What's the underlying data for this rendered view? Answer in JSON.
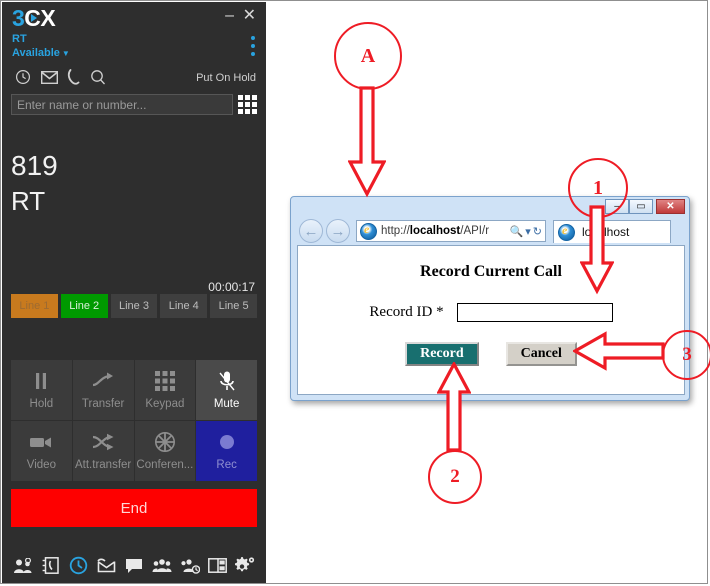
{
  "phone": {
    "brand": "3CX",
    "window_buttons": {
      "minimize": "–",
      "close": "✕"
    },
    "user": "RT",
    "presence": "Available",
    "put_on_hold": "Put On Hold",
    "toolbar_icons": [
      "history-icon",
      "voicemail-icon",
      "call-icon",
      "search-icon"
    ],
    "search": {
      "placeholder": "Enter name or number...",
      "value": ""
    },
    "dialpad_icon": "dialpad-icon",
    "call": {
      "number": "819",
      "name": "RT",
      "duration": "00:00:17"
    },
    "lines": [
      {
        "label": "Line 1",
        "state": "orange"
      },
      {
        "label": "Line 2",
        "state": "green"
      },
      {
        "label": "Line 3",
        "state": "idle"
      },
      {
        "label": "Line 4",
        "state": "idle"
      },
      {
        "label": "Line 5",
        "state": "idle"
      }
    ],
    "keys": [
      {
        "label": "Hold",
        "icon": "pause-icon",
        "state": "normal"
      },
      {
        "label": "Transfer",
        "icon": "transfer-icon",
        "state": "normal"
      },
      {
        "label": "Keypad",
        "icon": "keypad-icon",
        "state": "normal"
      },
      {
        "label": "Mute",
        "icon": "microphone-muted-icon",
        "state": "active"
      },
      {
        "label": "Video",
        "icon": "video-camera-icon",
        "state": "normal"
      },
      {
        "label": "Att.transfer",
        "icon": "attended-transfer-icon",
        "state": "normal"
      },
      {
        "label": "Conferen...",
        "icon": "conference-icon",
        "state": "normal"
      },
      {
        "label": "Rec",
        "icon": "record-dot-icon",
        "state": "recording"
      }
    ],
    "end_label": "End",
    "bottom_icons": [
      "contacts-icon",
      "phonebook-icon",
      "call-history-icon",
      "voicemail-icon",
      "chat-icon",
      "group-icon",
      "group-timer-icon",
      "panel-layout-icon",
      "settings-icon"
    ],
    "colors": {
      "brand_blue": "#29a3e0",
      "line_orange": "#c87a1e",
      "line_green": "#009a00",
      "record_blue": "#1f1f9e",
      "end_red": "#fe0000",
      "panel_bg": "#2e2e2e"
    }
  },
  "browser": {
    "title_buttons": {
      "minimize": "–",
      "maximize": "▭",
      "close": "✕"
    },
    "back_icon": "back-arrow-icon",
    "forward_icon": "forward-arrow-icon",
    "favicon": "internet-explorer-icon",
    "url_prefix": "http://",
    "url_host": "localhost",
    "url_path": "/API/r",
    "url_full": "http://localhost/API/r",
    "search_icon": "magnifier-icon",
    "dropdown_icon": "chevron-down-icon",
    "refresh_icon": "refresh-icon",
    "tab_label": "localhost"
  },
  "dialog": {
    "title": "Record Current Call",
    "field_label": "Record ID *",
    "field_value": "",
    "record_button": "Record",
    "cancel_button": "Cancel",
    "colors": {
      "record_bg": "#186f6f",
      "cancel_bg": "#d4d0c8"
    }
  },
  "annotations": {
    "accent": "#ee1c25",
    "markers": [
      {
        "id": "A",
        "label": "A",
        "points_to": "browser-window"
      },
      {
        "id": "1",
        "label": "1",
        "points_to": "record-id-input"
      },
      {
        "id": "2",
        "label": "2",
        "points_to": "record-button"
      },
      {
        "id": "3",
        "label": "3",
        "points_to": "cancel-button"
      }
    ]
  }
}
